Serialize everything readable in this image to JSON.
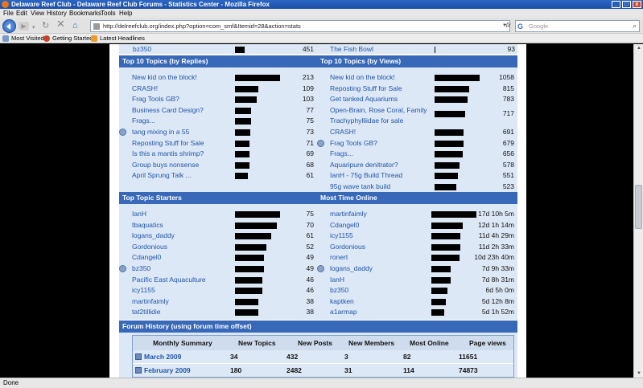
{
  "window": {
    "title": "Delaware Reef Club - Delaware Reef Club Forums - Statistics Center - Mozilla Firefox"
  },
  "menu": [
    "File",
    "Edit",
    "View",
    "History",
    "Bookmarks",
    "Tools",
    "Help"
  ],
  "toolbar": {
    "url": "http://delreefclub.org/index.php?option=com_smf&Itemid=28&action=stats",
    "search_placeholder": "Google"
  },
  "bookmarks": [
    "Most Visited",
    "Getting Started",
    "Latest Headlines"
  ],
  "status": "Done",
  "prev_rows": [
    {
      "label": "bz350",
      "value": "451",
      "bar": 0.22
    },
    {
      "label": "The Fish Bowl",
      "value": "93",
      "bar": 0.02
    }
  ],
  "sections": [
    {
      "title": "Top 10 Topics (by Replies)",
      "rows": [
        {
          "label": "New kid on the block!",
          "value": "213",
          "bar": 1.0
        },
        {
          "label": "CRASH!",
          "value": "109",
          "bar": 0.51
        },
        {
          "label": "Frag Tools GB?",
          "value": "103",
          "bar": 0.48
        },
        {
          "label": "Business Card Design?",
          "value": "77",
          "bar": 0.36
        },
        {
          "label": "Frags...",
          "value": "75",
          "bar": 0.35
        },
        {
          "label": "tang mixing in a 55",
          "value": "73",
          "bar": 0.34
        },
        {
          "label": "Reposting Stuff for Sale",
          "value": "71",
          "bar": 0.33
        },
        {
          "label": "Is this a mantis shrimp?",
          "value": "69",
          "bar": 0.32
        },
        {
          "label": "Group buys nonsense",
          "value": "68",
          "bar": 0.32
        },
        {
          "label": "April Sprung Talk ...",
          "value": "61",
          "bar": 0.29
        }
      ]
    },
    {
      "title": "Top 10 Topics (by Views)",
      "rows": [
        {
          "label": "New kid on the block!",
          "value": "1058",
          "bar": 1.0
        },
        {
          "label": "Reposting Stuff for Sale",
          "value": "815",
          "bar": 0.77
        },
        {
          "label": "Get tanked Aquariums",
          "value": "783",
          "bar": 0.74
        },
        {
          "label": "Open-Brain, Rose Coral, Family",
          "label2": "Trachyphylliidae for sale",
          "value": "717",
          "bar": 0.68
        },
        {
          "label": "CRASH!",
          "value": "691",
          "bar": 0.65
        },
        {
          "label": "Frag Tools GB?",
          "value": "679",
          "bar": 0.64
        },
        {
          "label": "Frags...",
          "value": "656",
          "bar": 0.62
        },
        {
          "label": "Aquaripure denitrator?",
          "value": "578",
          "bar": 0.55
        },
        {
          "label": "IanH - 75g Build Thread",
          "value": "551",
          "bar": 0.52
        },
        {
          "label": "95g wave tank build",
          "value": "523",
          "bar": 0.49
        }
      ]
    },
    {
      "title": "Top Topic Starters",
      "rows": [
        {
          "label": "IanH",
          "value": "75",
          "bar": 1.0
        },
        {
          "label": "tbaquatics",
          "value": "70",
          "bar": 0.93
        },
        {
          "label": "logans_daddy",
          "value": "61",
          "bar": 0.81
        },
        {
          "label": "Gordonious",
          "value": "52",
          "bar": 0.69
        },
        {
          "label": "Cdangel0",
          "value": "49",
          "bar": 0.65
        },
        {
          "label": "bz350",
          "value": "49",
          "bar": 0.65
        },
        {
          "label": "Pacific East Aquaculture",
          "value": "46",
          "bar": 0.61
        },
        {
          "label": "icy1155",
          "value": "46",
          "bar": 0.61
        },
        {
          "label": "martinfaimly",
          "value": "38",
          "bar": 0.51
        },
        {
          "label": "tat2tillidie",
          "value": "38",
          "bar": 0.51
        }
      ]
    },
    {
      "title": "Most Time Online",
      "rows": [
        {
          "label": "martinfaimly",
          "value": "17d 10h 5m",
          "bar": 1.0
        },
        {
          "label": "Cdangel0",
          "value": "12d 1h 14m",
          "bar": 0.69
        },
        {
          "label": "icy1155",
          "value": "11d 4h 29m",
          "bar": 0.64
        },
        {
          "label": "Gordonious",
          "value": "11d 2h 33m",
          "bar": 0.64
        },
        {
          "label": "ronert",
          "value": "10d 23h 40m",
          "bar": 0.63
        },
        {
          "label": "logans_daddy",
          "value": "7d 9h 33m",
          "bar": 0.43
        },
        {
          "label": "IanH",
          "value": "7d 8h 31m",
          "bar": 0.42
        },
        {
          "label": "bz350",
          "value": "6d 5h 0m",
          "bar": 0.36
        },
        {
          "label": "kaptken",
          "value": "5d 12h 8m",
          "bar": 0.32
        },
        {
          "label": "a1armap",
          "value": "5d 1h 52m",
          "bar": 0.29
        }
      ]
    }
  ],
  "forum_history": {
    "title": "Forum History (using forum time offset)",
    "headers": [
      "Monthly Summary",
      "New Topics",
      "New Posts",
      "New Members",
      "Most Online",
      "Page views"
    ],
    "rows": [
      [
        "March 2009",
        "34",
        "432",
        "3",
        "82",
        "11651"
      ],
      [
        "February 2009",
        "180",
        "2482",
        "31",
        "114",
        "74873"
      ]
    ]
  }
}
